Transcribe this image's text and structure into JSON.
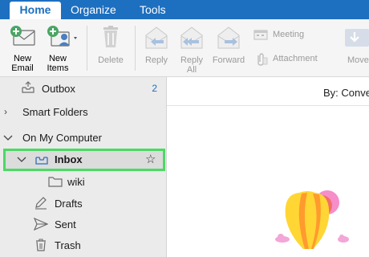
{
  "tabs": {
    "home": "Home",
    "organize": "Organize",
    "tools": "Tools"
  },
  "ribbon": {
    "new_email": "New Email",
    "new_items": "New Items",
    "delete": "Delete",
    "reply": "Reply",
    "reply_all": "Reply All",
    "forward": "Forward",
    "meeting": "Meeting",
    "attachment": "Attachment",
    "move": "Move"
  },
  "sidebar": {
    "outbox": "Outbox",
    "outbox_count": "2",
    "smart_folders": "Smart Folders",
    "on_my_computer": "On My Computer",
    "inbox": "Inbox",
    "wiki": "wiki",
    "drafts": "Drafts",
    "sent": "Sent",
    "trash": "Trash"
  },
  "main": {
    "sort_label": "By: Conve"
  }
}
